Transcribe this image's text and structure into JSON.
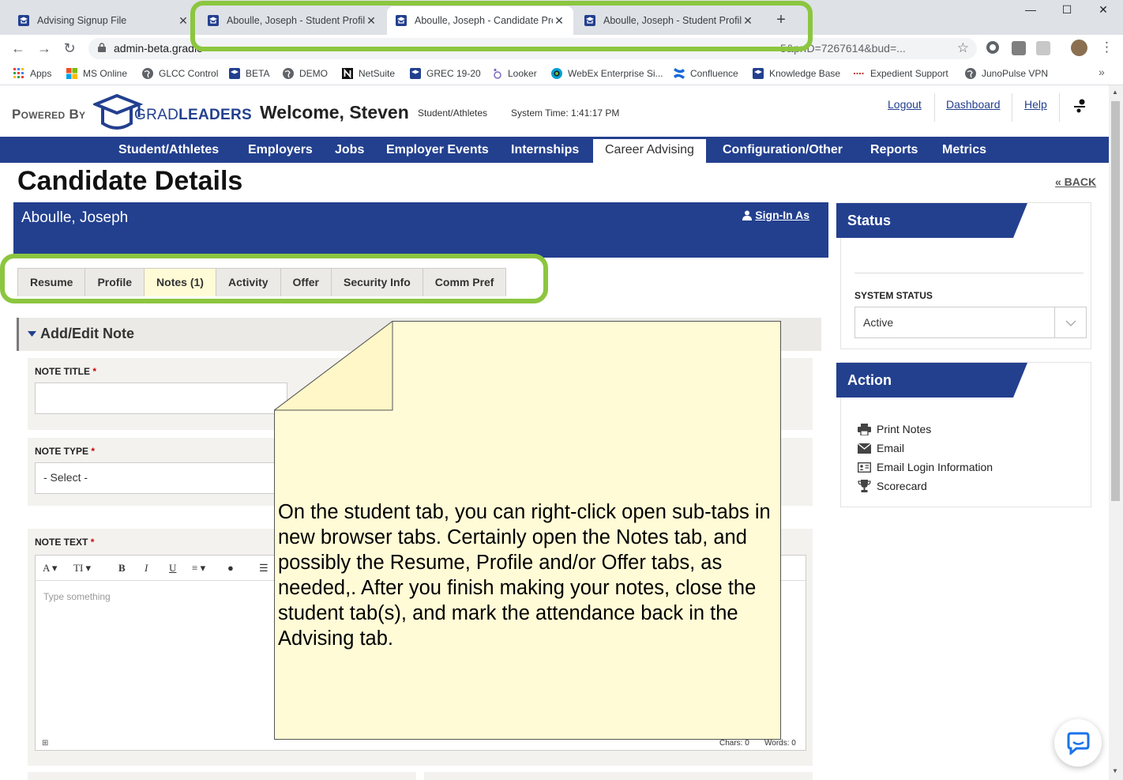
{
  "browser": {
    "tabs": [
      {
        "title": "Advising Signup File",
        "active": false
      },
      {
        "title": "Aboulle, Joseph - Student Profile",
        "active": false
      },
      {
        "title": "Aboulle, Joseph - Candidate Prof",
        "active": true
      },
      {
        "title": "Aboulle, Joseph - Student Profile",
        "active": false
      }
    ],
    "url": "admin-beta.gradle",
    "url_tail": "5&prID=7267614&bud=...",
    "bookmarks": [
      "Apps",
      "MS Online",
      "GLCC Control",
      "BETA",
      "DEMO",
      "NetSuite",
      "GREC 19-20",
      "Looker",
      "WebEx Enterprise Si...",
      "Confluence",
      "Knowledge Base",
      "Expedient Support",
      "JunoPulse VPN"
    ]
  },
  "header": {
    "powered_by": "Powered By",
    "logo_grad": "GRAD",
    "logo_leaders": "LEADERS",
    "welcome": "Welcome, Steven",
    "context": "Student/Athletes",
    "system_time": "System Time: 1:41:17 PM",
    "links": [
      "Logout",
      "Dashboard",
      "Help"
    ]
  },
  "main_nav": [
    "Student/Athletes",
    "Employers",
    "Jobs",
    "Employer Events",
    "Internships",
    "Career Advising",
    "Configuration/Other",
    "Reports",
    "Metrics"
  ],
  "main_nav_active": "Career Advising",
  "page": {
    "title": "Candidate Details",
    "back": "« BACK",
    "candidate_name": "Aboulle, Joseph",
    "sign_in_as": "Sign-In As",
    "subtabs": [
      "Resume",
      "Profile",
      "Notes (1)",
      "Activity",
      "Offer",
      "Security Info",
      "Comm Pref"
    ],
    "active_subtab": "Notes (1)",
    "section_title": "Add/Edit Note",
    "note_title_label": "NOTE TITLE",
    "note_type_label": "NOTE TYPE",
    "note_type_value": "- Select -",
    "note_text_label": "NOTE TEXT",
    "required_mark": "*",
    "editor_placeholder": "Type something",
    "chars": "Chars: 0",
    "words": "Words: 0",
    "toolbar": {
      "font": "A",
      "size": "TI",
      "bold": "B",
      "italic": "I",
      "underline": "U"
    }
  },
  "sidebar": {
    "status_title": "Status",
    "system_status_label": "SYSTEM STATUS",
    "system_status_value": "Active",
    "action_title": "Action",
    "actions": [
      "Print Notes",
      "Email",
      "Email Login Information",
      "Scorecard"
    ]
  },
  "callout": {
    "text": "On the student tab, you can right-click open sub-tabs in new browser tabs.  Certainly open the Notes tab, and possibly the Resume, Profile and/or Offer tabs, as needed,.  After you finish making your notes, close the student tab(s), and mark the attendance back in the Advising tab."
  },
  "colors": {
    "brand_blue": "#23408f",
    "highlight_green": "#8cc63f",
    "callout_fill": "#fffbd6",
    "active_subtab": "#fffbd6"
  }
}
